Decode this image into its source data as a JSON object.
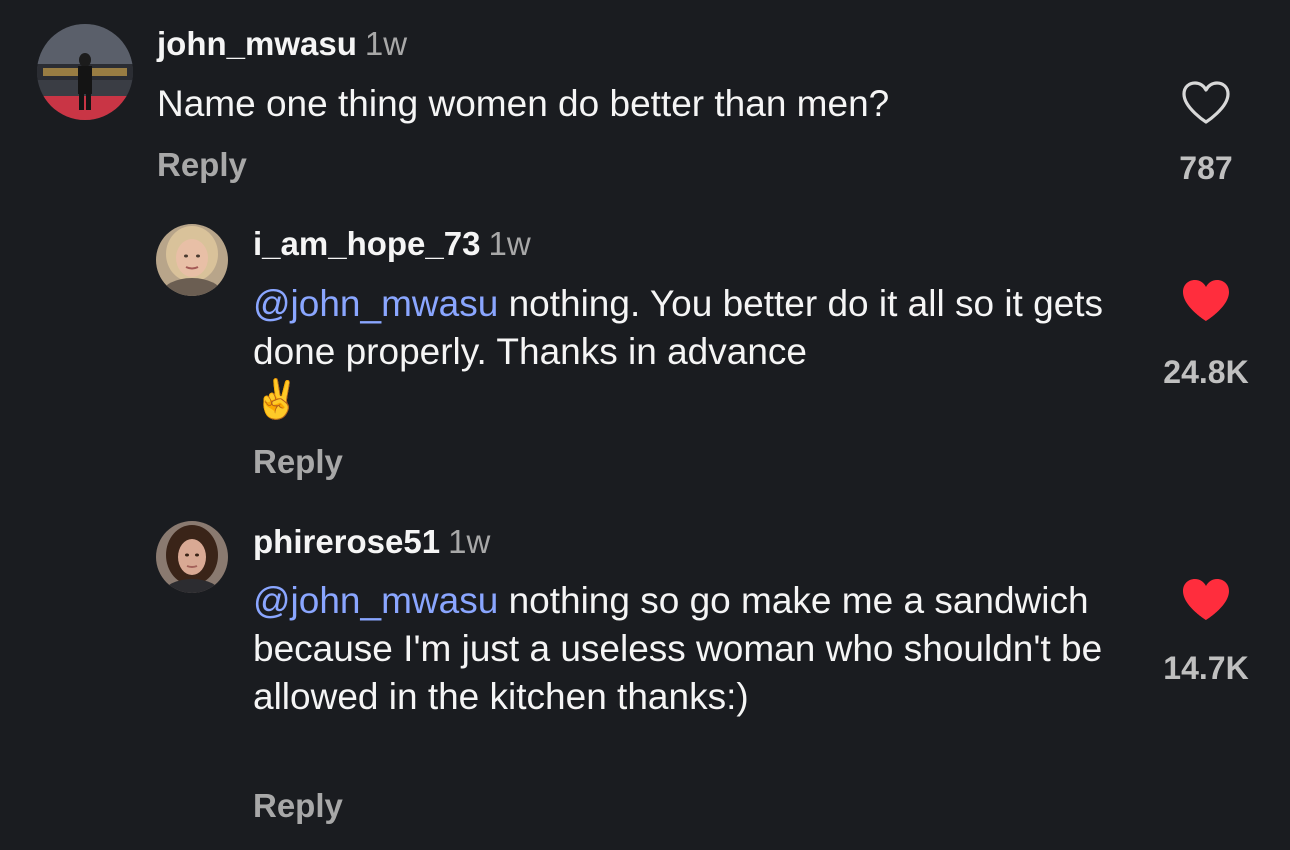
{
  "colors": {
    "background": "#1a1c20",
    "mention": "#8aa6ff",
    "liked_heart": "#ff2d3d",
    "muted_text": "#a8a8a8"
  },
  "comments": [
    {
      "username": "john_mwasu",
      "timestamp": "1w",
      "mention": "",
      "text": "Name one thing women do better than men?",
      "reply_label": "Reply",
      "like_count": "787",
      "liked": false,
      "icon": "heart-outline-icon"
    },
    {
      "username": "i_am_hope_73",
      "timestamp": "1w",
      "mention": "@john_mwasu",
      "text": " nothing. You better do it all so it gets done properly. Thanks in advance",
      "emoji": "✌️",
      "reply_label": "Reply",
      "like_count": "24.8K",
      "liked": true,
      "icon": "heart-filled-icon"
    },
    {
      "username": "phirerose51",
      "timestamp": "1w",
      "mention": "@john_mwasu",
      "text": " nothing so go make me a sandwich because I'm just a useless woman who shouldn't be allowed in the kitchen thanks:)",
      "reply_label": "Reply",
      "like_count": "14.7K",
      "liked": true,
      "icon": "heart-filled-icon"
    }
  ]
}
